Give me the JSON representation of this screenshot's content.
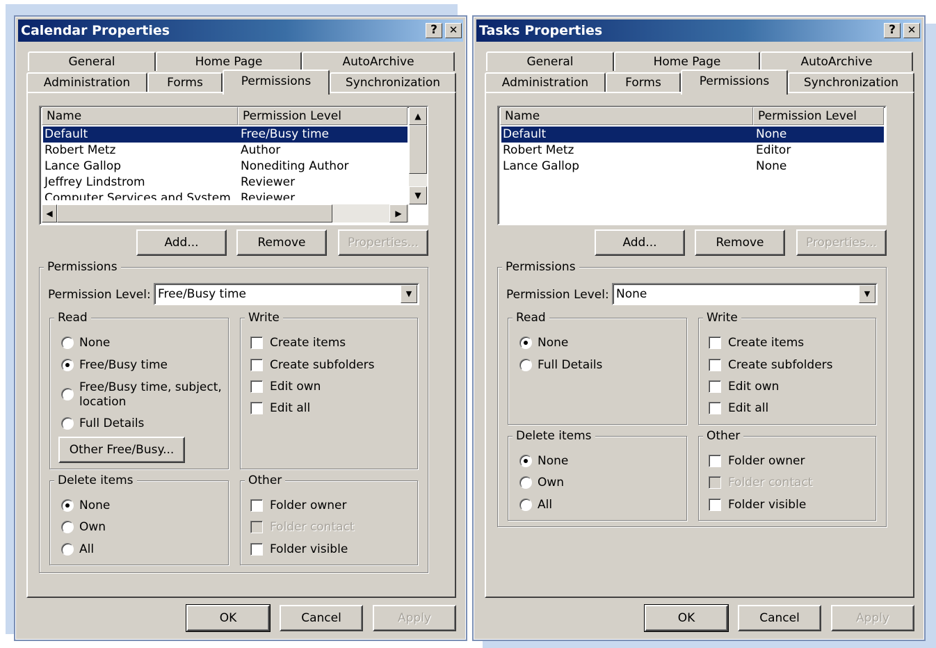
{
  "calendar": {
    "title": "Calendar Properties",
    "help_label": "?",
    "close_label": "✕",
    "tabs_row1": [
      "General",
      "Home Page",
      "AutoArchive"
    ],
    "tabs_row2": [
      "Administration",
      "Forms",
      "Permissions",
      "Synchronization"
    ],
    "active_tab": "Permissions",
    "list": {
      "col_name": "Name",
      "col_level": "Permission Level",
      "rows": [
        {
          "name": "Default",
          "level": "Free/Busy time"
        },
        {
          "name": "Robert Metz",
          "level": "Author"
        },
        {
          "name": "Lance Gallop",
          "level": "Nonediting Author"
        },
        {
          "name": "Jeffrey Lindstrom",
          "level": "Reviewer"
        },
        {
          "name": "Computer Services and System",
          "level": "Reviewer"
        }
      ],
      "selected_index": 0
    },
    "add_label": "Add...",
    "remove_label": "Remove",
    "properties_label": "Properties...",
    "permissions_group": "Permissions",
    "permission_level_label": "Permission Level:",
    "permission_level_value": "Free/Busy time",
    "read_group": "Read",
    "read_options": [
      "None",
      "Free/Busy time",
      "Free/Busy time, subject,",
      "location",
      "Full Details"
    ],
    "read_selected": "Free/Busy time",
    "other_freebusy_label": "Other Free/Busy...",
    "write_group": "Write",
    "write_options": [
      "Create items",
      "Create subfolders",
      "Edit own",
      "Edit all"
    ],
    "delete_group": "Delete items",
    "delete_options": [
      "None",
      "Own",
      "All"
    ],
    "delete_selected": "None",
    "other_group": "Other",
    "other_options": [
      "Folder owner",
      "Folder contact",
      "Folder visible"
    ],
    "ok_label": "OK",
    "cancel_label": "Cancel",
    "apply_label": "Apply"
  },
  "tasks": {
    "title": "Tasks Properties",
    "help_label": "?",
    "close_label": "✕",
    "tabs_row1": [
      "General",
      "Home Page",
      "AutoArchive"
    ],
    "tabs_row2": [
      "Administration",
      "Forms",
      "Permissions",
      "Synchronization"
    ],
    "active_tab": "Permissions",
    "list": {
      "col_name": "Name",
      "col_level": "Permission Level",
      "rows": [
        {
          "name": "Default",
          "level": "None"
        },
        {
          "name": "Robert Metz",
          "level": "Editor"
        },
        {
          "name": "Lance Gallop",
          "level": "None"
        }
      ],
      "selected_index": 0
    },
    "add_label": "Add...",
    "remove_label": "Remove",
    "properties_label": "Properties...",
    "permissions_group": "Permissions",
    "permission_level_label": "Permission Level:",
    "permission_level_value": "None",
    "read_group": "Read",
    "read_options": [
      "None",
      "Full Details"
    ],
    "read_selected": "None",
    "write_group": "Write",
    "write_options": [
      "Create items",
      "Create subfolders",
      "Edit own",
      "Edit all"
    ],
    "delete_group": "Delete items",
    "delete_options": [
      "None",
      "Own",
      "All"
    ],
    "delete_selected": "None",
    "other_group": "Other",
    "other_options": [
      "Folder owner",
      "Folder contact",
      "Folder visible"
    ],
    "ok_label": "OK",
    "cancel_label": "Cancel",
    "apply_label": "Apply"
  }
}
